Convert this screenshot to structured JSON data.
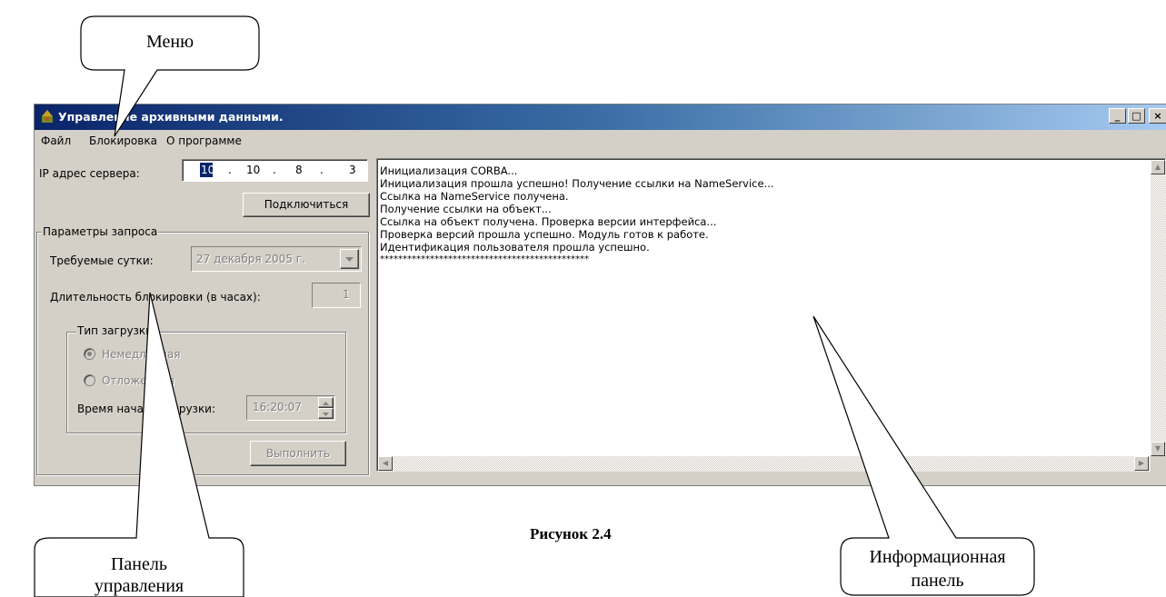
{
  "window": {
    "title": "Управление архивными данными.",
    "buttons": {
      "minimize": "_",
      "maximize": "□",
      "close": "×"
    }
  },
  "menu": [
    "Файл",
    "Блокировка",
    "О программе"
  ],
  "server": {
    "label": "IP адрес сервера:",
    "ip": [
      "10",
      "10",
      "8",
      "3"
    ],
    "connect_button": "Подключиться"
  },
  "query": {
    "group_label": "Параметры запроса",
    "day_label": "Требуемые сутки:",
    "day_value": "27 декабря 2005 г.",
    "duration_label": "Длительность блокировки (в часах):",
    "duration_value": "1",
    "load_type": {
      "group_label": "Тип загрузки",
      "options": [
        {
          "label": "Немедленная",
          "selected": true
        },
        {
          "label": "Отложенная",
          "selected": false
        }
      ],
      "start_time_label": "Время начала загрузки:",
      "start_time_value": "16:20:07"
    },
    "execute_button": "Выполнить"
  },
  "log": [
    "Инициализация CORBA...",
    "Инициализация прошла успешно! Получение ссылки на NameService...",
    "Ссылка на NameService получена.",
    "Получение ссылки на объект...",
    "Ссылка на объект получена. Проверка версии интерфейса...",
    "Проверка версий прошла успешно. Модуль готов к работе.",
    "Идентификация пользователя прошла успешно.",
    "**********************************************"
  ],
  "annotations": {
    "menu": "Меню",
    "control_panel_line1": "Панель",
    "control_panel_line2": "управления",
    "info_panel_line1": "Информационная",
    "info_panel_line2": "панель",
    "caption": "Рисунок 2.4"
  },
  "colors": {
    "title_start": "#0a246a",
    "title_end": "#a6caf0",
    "face": "#d4d0c8"
  }
}
